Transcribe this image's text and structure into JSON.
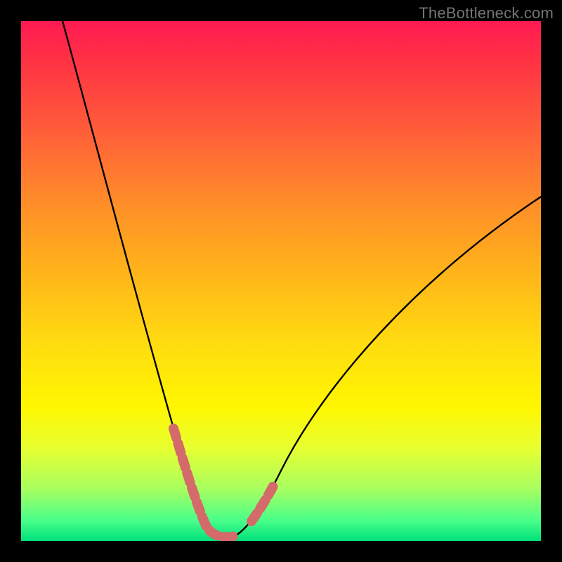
{
  "watermark": "TheBottleneck.com",
  "chart_data": {
    "type": "line",
    "title": "",
    "xlabel": "",
    "ylabel": "",
    "xlim": [
      0,
      100
    ],
    "ylim": [
      0,
      100
    ],
    "series": [
      {
        "name": "bottleneck-curve",
        "x": [
          8,
          10,
          12,
          14,
          16,
          18,
          20,
          22,
          24,
          26,
          28,
          30,
          32,
          34,
          35,
          36,
          38,
          40,
          42,
          44,
          46,
          50,
          55,
          60,
          65,
          70,
          75,
          80,
          85,
          90,
          95,
          100
        ],
        "y": [
          100,
          93,
          86,
          79,
          72,
          65,
          58,
          51,
          44,
          37,
          30,
          23,
          16,
          8,
          4,
          1,
          0,
          0,
          0,
          2,
          6,
          12,
          20,
          27,
          33,
          39,
          44,
          49,
          54,
          58,
          62,
          66
        ]
      }
    ],
    "highlight_segments": [
      {
        "name": "left-descent-highlight",
        "x_range": [
          29,
          35
        ],
        "approx_y_range": [
          23,
          4
        ]
      },
      {
        "name": "right-ascent-highlight",
        "x_range": [
          44,
          48
        ],
        "approx_y_range": [
          2,
          10
        ]
      }
    ],
    "background_gradient": {
      "top_color": "#ff1a52",
      "mid_color": "#fff600",
      "bottom_color": "#00e07a"
    }
  }
}
